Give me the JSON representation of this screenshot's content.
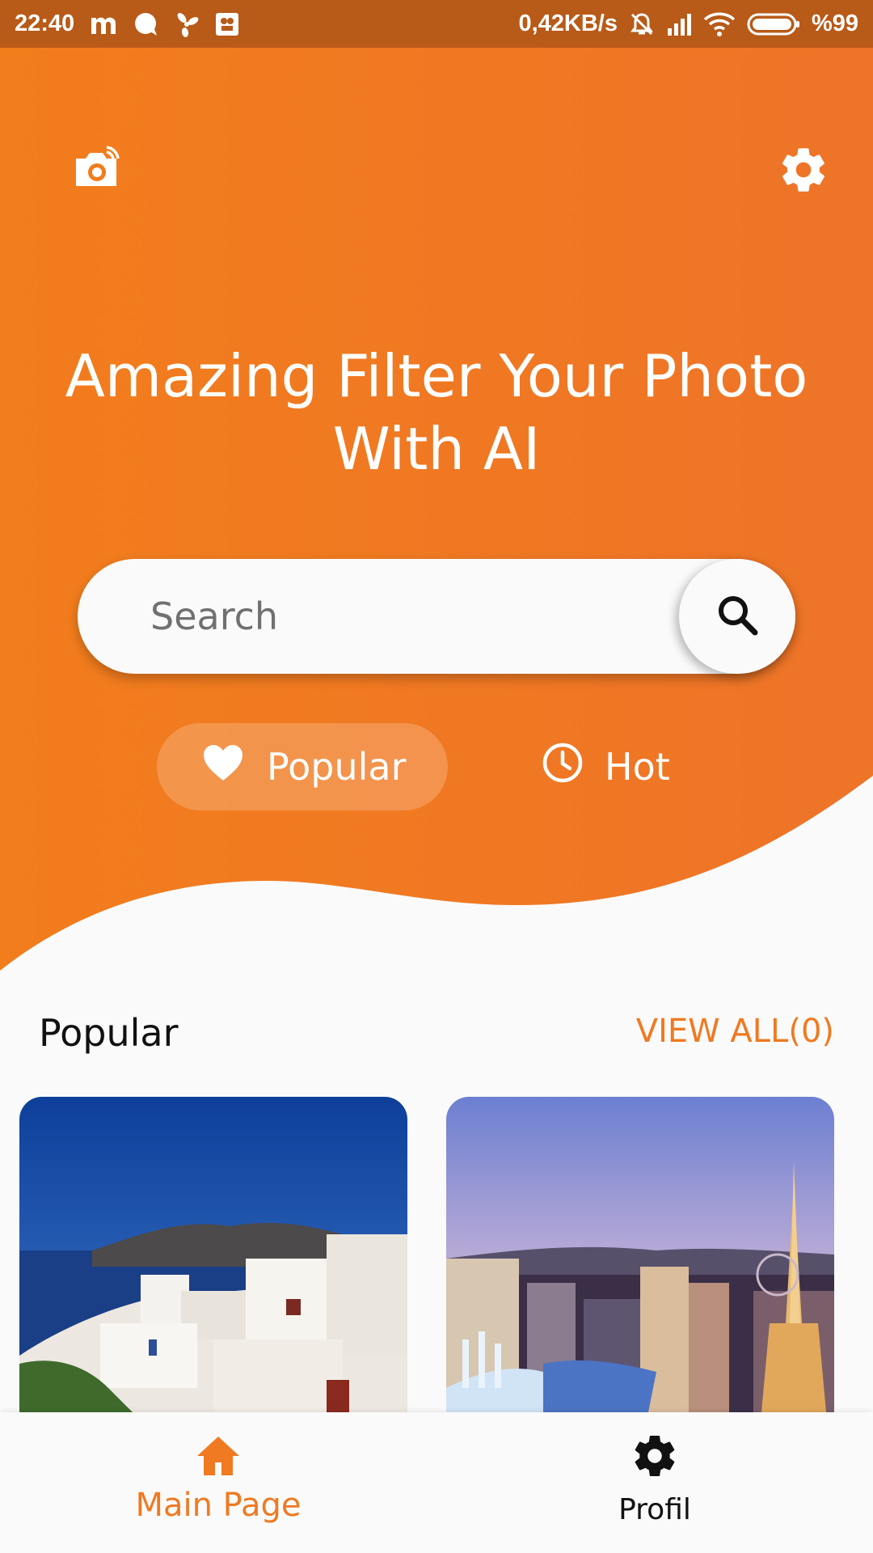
{
  "status_bar": {
    "time": "22:40",
    "net_speed": "0,42KB/s",
    "battery": "%99",
    "icons": [
      "m-app-icon",
      "chat-icon",
      "fan-icon",
      "app-icon",
      "mute-icon",
      "signal-icon",
      "wifi-icon",
      "battery-icon"
    ]
  },
  "header": {
    "headline_line1": "Amazing Filter Your Photo",
    "headline_line2": "With AI",
    "camera_icon": "camera-icon",
    "settings_icon": "gear-icon"
  },
  "search": {
    "placeholder": "Search",
    "value": "",
    "button_icon": "search-icon"
  },
  "tabs": [
    {
      "label": "Popular",
      "icon": "heart-icon",
      "selected": true
    },
    {
      "label": "Hot",
      "icon": "clock-icon",
      "selected": false
    }
  ],
  "section": {
    "title": "Popular",
    "view_all": "VIEW ALL(0)"
  },
  "cards": [
    {
      "image": "santorini-photo"
    },
    {
      "image": "las-vegas-photo"
    }
  ],
  "bottom_nav": [
    {
      "label": "Main Page",
      "icon": "home-icon",
      "active": true
    },
    {
      "label": "Profil",
      "icon": "gear-icon",
      "active": false
    }
  ],
  "colors": {
    "accent": "#ef7a22",
    "status_bar": "#b85a18",
    "background": "#fafafa"
  }
}
